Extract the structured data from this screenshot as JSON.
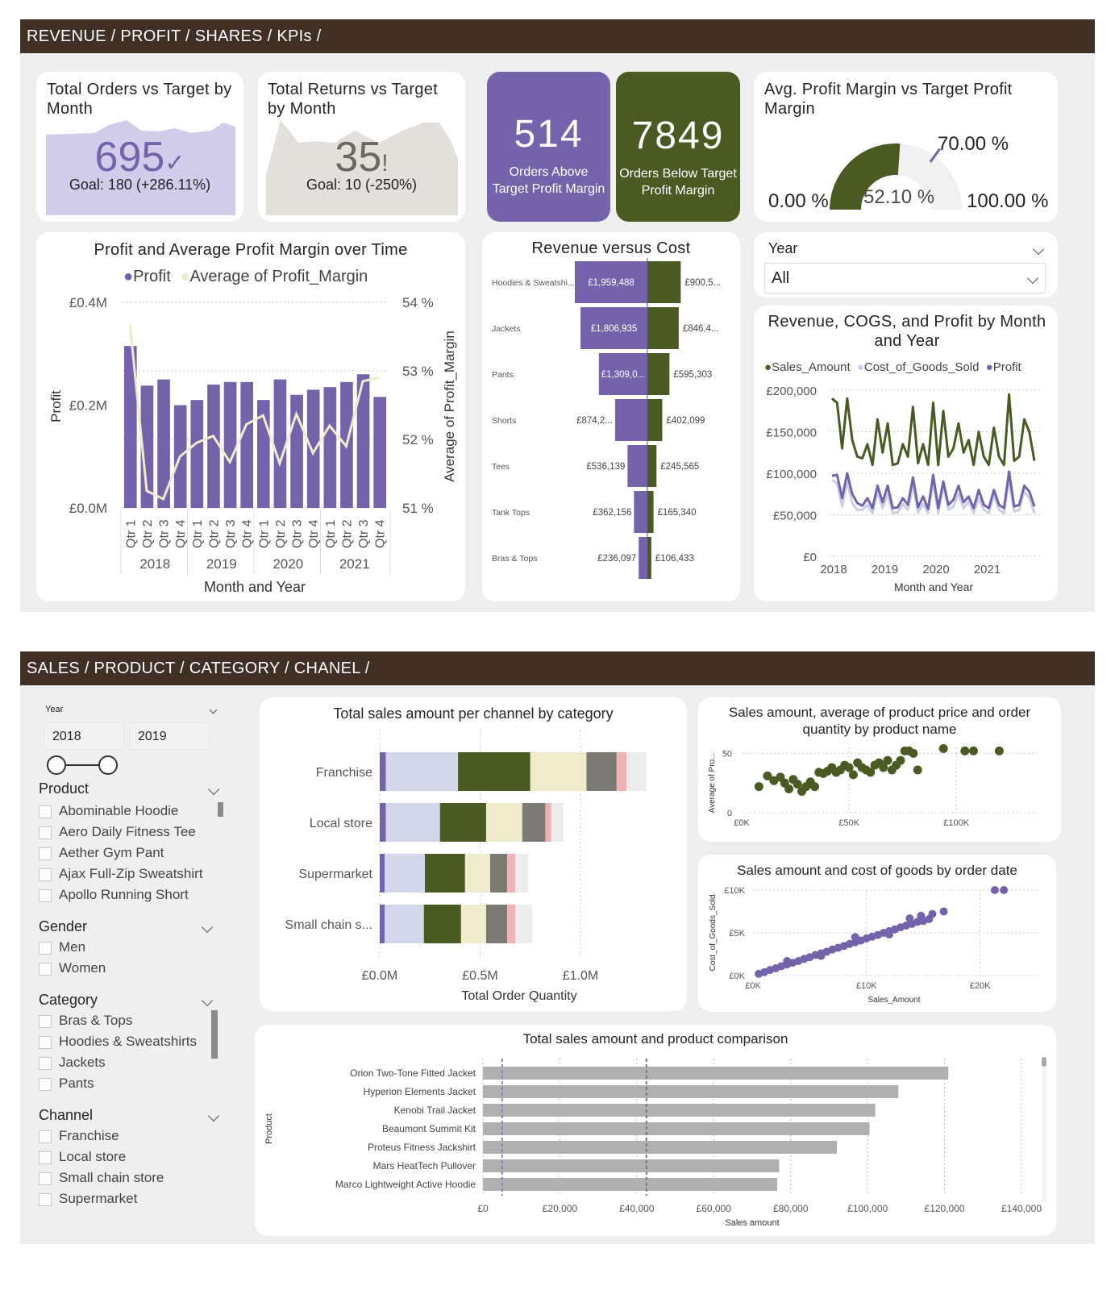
{
  "sections": {
    "top_title": "REVENUE / PROFIT / SHARES / KPIs /",
    "bottom_title": "SALES / PRODUCT / CATEGORY / CHANEL /"
  },
  "kpi_orders": {
    "title": "Total Orders vs Target by Month",
    "value": "695",
    "goal": "Goal: 180 (+286.11%)",
    "status_icon": "checkmark-icon",
    "color": "#7462ab"
  },
  "kpi_returns": {
    "title": "Total Returns vs Target by Month",
    "value": "35",
    "goal": "Goal: 10 (-250%)",
    "status_icon": "exclamation-icon",
    "color": "#6b6862"
  },
  "card_above": {
    "value": "514",
    "label": "Orders Above Target Profit Margin",
    "color": "#7462ab"
  },
  "card_below": {
    "value": "7849",
    "label": "Orders Below Target Profit Margin",
    "color": "#4a5a23"
  },
  "gauge": {
    "title": "Avg. Profit Margin vs Target Profit Margin",
    "value": 52.1,
    "value_label": "52.10 %",
    "min_label": "0.00 %",
    "max_label": "100.00 %",
    "target": 70.0,
    "target_label": "70.00 %"
  },
  "year_filter": {
    "label": "Year",
    "value": "All"
  },
  "bottom_slicers": {
    "year": {
      "label": "Year",
      "from": "2018",
      "to": "2019"
    },
    "product": {
      "label": "Product",
      "items": [
        "Abominable Hoodie",
        "Aero Daily Fitness Tee",
        "Aether Gym Pant",
        "Ajax Full-Zip Sweatshirt",
        "Apollo Running Short"
      ]
    },
    "gender": {
      "label": "Gender",
      "items": [
        "Men",
        "Women"
      ]
    },
    "category": {
      "label": "Category",
      "items": [
        "Bras & Tops",
        "Hoodies & Sweatshirts",
        "Jackets",
        "Pants"
      ]
    },
    "channel": {
      "label": "Channel",
      "items": [
        "Franchise",
        "Local store",
        "Small chain store",
        "Supermarket"
      ]
    }
  },
  "chart_data": [
    {
      "id": "profit_margin_over_time",
      "type": "bar",
      "title": "Profit and Average Profit Margin over Time",
      "legend": [
        "Profit",
        "Average of Profit_Margin"
      ],
      "legend_position": "top",
      "colors": {
        "bars": "#7462ab",
        "line": "#f0eccb"
      },
      "categories": [
        "Qtr 1",
        "Qtr 2",
        "Qtr 3",
        "Qtr 4",
        "Qtr 1",
        "Qtr 2",
        "Qtr 3",
        "Qtr 4",
        "Qtr 1",
        "Qtr 2",
        "Qtr 3",
        "Qtr 4",
        "Qtr 1",
        "Qtr 2",
        "Qtr 3",
        "Qtr 4"
      ],
      "years": [
        "2018",
        "2019",
        "2020",
        "2021"
      ],
      "series": [
        {
          "name": "Profit",
          "values": [
            0.315,
            0.238,
            0.25,
            0.2,
            0.21,
            0.24,
            0.245,
            0.245,
            0.21,
            0.25,
            0.22,
            0.23,
            0.235,
            0.245,
            0.26,
            0.216
          ]
        },
        {
          "name": "Average of Profit_Margin",
          "values": [
            53.67,
            51.25,
            51.13,
            51.75,
            51.95,
            52.05,
            51.67,
            52.22,
            52.35,
            51.65,
            52.37,
            51.8,
            52.2,
            51.9,
            52.85,
            52.9
          ]
        }
      ],
      "xlabel": "Month and Year",
      "ylabel": "Profit",
      "y2label": "Average of Profit_Margin",
      "yticks": [
        "£0.0M",
        "£0.2M",
        "£0.4M"
      ],
      "y2ticks": [
        "51 %",
        "52 %",
        "53 %",
        "54 %"
      ],
      "ylim": [
        0,
        0.4
      ],
      "y2lim": [
        51,
        54
      ]
    },
    {
      "id": "revenue_vs_cost",
      "type": "bar",
      "title": "Revenue versus Cost",
      "categories": [
        "Hoodies & Sweatshi...",
        "Jackets",
        "Pants",
        "Shorts",
        "Tees",
        "Tank Tops",
        "Bras & Tops"
      ],
      "series": [
        {
          "name": "Revenue",
          "values": [
            1959488,
            1806935,
            1309000,
            874200,
            536139,
            362156,
            236097
          ],
          "labels": [
            "£1,959,488",
            "£1,806,935",
            "£1,309,0...",
            "£874,2...",
            "£536,139",
            "£362,156",
            "£236,097"
          ]
        },
        {
          "name": "Cost",
          "values": [
            900500,
            846400,
            595303,
            402099,
            245565,
            165340,
            106433
          ],
          "labels": [
            "£900,5...",
            "£846,4...",
            "£595,303",
            "£402,099",
            "£245,565",
            "£165,340",
            "£106,433"
          ]
        }
      ],
      "colors": {
        "revenue": "#7462ab",
        "cost": "#4a5a23"
      }
    },
    {
      "id": "revenue_cogs_profit",
      "type": "line",
      "title": "Revenue, COGS, and Profit by Month and Year",
      "legend": [
        "Sales_Amount",
        "Cost_of_Goods_Sold",
        "Profit"
      ],
      "legend_position": "top",
      "colors": [
        "#4a5a23",
        "#c8cfe6",
        "#7462ab"
      ],
      "xlabel": "Month and Year",
      "xticks": [
        "2018",
        "2019",
        "2020",
        "2021"
      ],
      "yticks": [
        "£0",
        "£50,000",
        "£100,000",
        "£150,000",
        "£200,000"
      ],
      "ylim": [
        0,
        200000
      ],
      "series": [
        {
          "name": "Sales_Amount",
          "values": [
            190000,
            185000,
            130000,
            190000,
            140000,
            120000,
            118000,
            135000,
            110000,
            165000,
            125000,
            160000,
            110000,
            112000,
            135000,
            120000,
            180000,
            112000,
            135000,
            110000,
            185000,
            110000,
            175000,
            120000,
            130000,
            160000,
            125000,
            140000,
            110000,
            150000,
            120000,
            110000,
            155000,
            120000,
            110000,
            195000,
            115000,
            120000,
            165000,
            150000,
            115000
          ]
        },
        {
          "name": "Profit",
          "values": [
            97000,
            98000,
            70000,
            100000,
            75000,
            64000,
            61000,
            70000,
            58000,
            85000,
            65000,
            85000,
            58000,
            59000,
            70000,
            62000,
            95000,
            59000,
            72000,
            57000,
            98000,
            58000,
            90000,
            62000,
            68000,
            85000,
            65000,
            72000,
            58000,
            80000,
            62000,
            58000,
            80000,
            62000,
            58000,
            102000,
            60000,
            62000,
            85000,
            78000,
            60000
          ]
        },
        {
          "name": "Cost_of_Goods_Sold",
          "values": [
            92000,
            88000,
            60000,
            90000,
            64000,
            56000,
            56000,
            62000,
            52000,
            78000,
            58000,
            75000,
            52000,
            53000,
            63000,
            56000,
            85000,
            53000,
            63000,
            52000,
            88000,
            52000,
            85000,
            56000,
            60000,
            75000,
            58000,
            66000,
            52000,
            70000,
            56000,
            52000,
            74000,
            56000,
            52000,
            92000,
            54000,
            56000,
            78000,
            70000,
            52000
          ]
        }
      ]
    },
    {
      "id": "sales_by_channel_category",
      "type": "bar",
      "title": "Total sales amount per channel by category",
      "xlabel": "Total Order Quantity",
      "xticks": [
        "£0.0M",
        "£0.5M",
        "£1.0M"
      ],
      "xlim": [
        0,
        1.0
      ],
      "categories": [
        "Franchise",
        "Local store",
        "Supermarket",
        "Small chain s..."
      ],
      "segment_colors": [
        "#7462ab",
        "#d2d7ea",
        "#4a5a23",
        "#f0eccb",
        "#7a7a72",
        "#efb3b3",
        "#ededed"
      ],
      "series": [
        {
          "name": "segment-1",
          "values": [
            0.03,
            0.03,
            0.025,
            0.025
          ]
        },
        {
          "name": "segment-2",
          "values": [
            0.36,
            0.27,
            0.2,
            0.195
          ]
        },
        {
          "name": "segment-3",
          "values": [
            0.36,
            0.23,
            0.2,
            0.185
          ]
        },
        {
          "name": "segment-4",
          "values": [
            0.28,
            0.18,
            0.125,
            0.125
          ]
        },
        {
          "name": "segment-5",
          "values": [
            0.15,
            0.115,
            0.085,
            0.105
          ]
        },
        {
          "name": "segment-6",
          "values": [
            0.05,
            0.03,
            0.04,
            0.04
          ]
        },
        {
          "name": "segment-7",
          "values": [
            0.1,
            0.06,
            0.065,
            0.085
          ]
        }
      ]
    },
    {
      "id": "sales_price_quantity",
      "type": "scatter",
      "title": "Sales amount, average of product price and order quantity by product name",
      "xlabel": "",
      "ylabel": "Average of Pro...",
      "xticks": [
        "£0K",
        "£50K",
        "£100K"
      ],
      "yticks": [
        "0",
        "50"
      ],
      "xlim": [
        0,
        130000
      ],
      "ylim": [
        0,
        55
      ],
      "color": "#4a5a23",
      "points": [
        [
          8000,
          22
        ],
        [
          12000,
          31
        ],
        [
          15000,
          27
        ],
        [
          18000,
          30
        ],
        [
          20000,
          25
        ],
        [
          22000,
          20
        ],
        [
          24000,
          28
        ],
        [
          26000,
          24
        ],
        [
          28000,
          18
        ],
        [
          30000,
          22
        ],
        [
          32000,
          26
        ],
        [
          34000,
          22
        ],
        [
          36000,
          34
        ],
        [
          38000,
          33
        ],
        [
          40000,
          35
        ],
        [
          42000,
          38
        ],
        [
          44000,
          34
        ],
        [
          46000,
          36
        ],
        [
          48000,
          40
        ],
        [
          50000,
          38
        ],
        [
          52000,
          32
        ],
        [
          54000,
          42
        ],
        [
          56000,
          38
        ],
        [
          58000,
          36
        ],
        [
          60000,
          34
        ],
        [
          62000,
          40
        ],
        [
          64000,
          42
        ],
        [
          66000,
          38
        ],
        [
          68000,
          44
        ],
        [
          70000,
          36
        ],
        [
          72000,
          40
        ],
        [
          74000,
          44
        ],
        [
          76000,
          52
        ],
        [
          78000,
          52
        ],
        [
          80000,
          50
        ],
        [
          82000,
          36
        ],
        [
          94000,
          54
        ],
        [
          104000,
          52
        ],
        [
          108000,
          52
        ],
        [
          120000,
          52
        ]
      ]
    },
    {
      "id": "sales_vs_cost_by_date",
      "type": "scatter",
      "title": "Sales amount and cost of goods by order date",
      "xlabel": "Sales_Amount",
      "ylabel": "Cost_of_Goods_Sold",
      "xticks": [
        "£0K",
        "£10K",
        "£20K"
      ],
      "yticks": [
        "£0K",
        "£5K",
        "£10K"
      ],
      "xlim": [
        0,
        25000
      ],
      "ylim": [
        0,
        10000
      ],
      "color": "#7462ab",
      "points": [
        [
          500,
          200
        ],
        [
          1000,
          400
        ],
        [
          1500,
          650
        ],
        [
          2000,
          850
        ],
        [
          2500,
          1100
        ],
        [
          3000,
          1300
        ],
        [
          3500,
          1500
        ],
        [
          4000,
          1700
        ],
        [
          4500,
          1950
        ],
        [
          5000,
          2150
        ],
        [
          5500,
          2400
        ],
        [
          6000,
          2600
        ],
        [
          6500,
          2800
        ],
        [
          7000,
          3050
        ],
        [
          7500,
          3250
        ],
        [
          8000,
          3450
        ],
        [
          8500,
          3700
        ],
        [
          9000,
          3900
        ],
        [
          9500,
          4100
        ],
        [
          10000,
          4350
        ],
        [
          10500,
          4550
        ],
        [
          11000,
          4750
        ],
        [
          11500,
          5000
        ],
        [
          12000,
          5200
        ],
        [
          12500,
          5400
        ],
        [
          13000,
          5650
        ],
        [
          13500,
          5850
        ],
        [
          14000,
          6050
        ],
        [
          14500,
          6300
        ],
        [
          15000,
          6400
        ],
        [
          15500,
          6600
        ],
        [
          3000,
          1700
        ],
        [
          6000,
          2300
        ],
        [
          9000,
          4500
        ],
        [
          12000,
          4800
        ],
        [
          13800,
          6700
        ],
        [
          14800,
          7000
        ],
        [
          15800,
          7200
        ],
        [
          16800,
          7500
        ],
        [
          21300,
          10000
        ],
        [
          22100,
          10000
        ]
      ]
    },
    {
      "id": "product_comparison",
      "type": "bar",
      "title": "Total sales amount and product comparison",
      "xlabel": "Sales amount",
      "ylabel": "Product",
      "xticks": [
        "£0",
        "£20,000",
        "£40,000",
        "£60,000",
        "£80,000",
        "£100,000",
        "£120,000",
        "£140,000"
      ],
      "xlim": [
        0,
        140000
      ],
      "categories": [
        "Orion Two-Tone Fitted Jacket",
        "Hyperion Elements Jacket",
        "Kenobi Trail Jacket",
        "Beaumont Summit Kit",
        "Proteus Fitness Jackshirt",
        "Mars HeatTech Pullover",
        "Marco Lightweight Active Hoodie"
      ],
      "values": [
        121000,
        108000,
        102000,
        100500,
        92000,
        77000,
        76500
      ],
      "reference_lines": [
        5000,
        42500
      ],
      "color": "#b0b0b0"
    }
  ]
}
